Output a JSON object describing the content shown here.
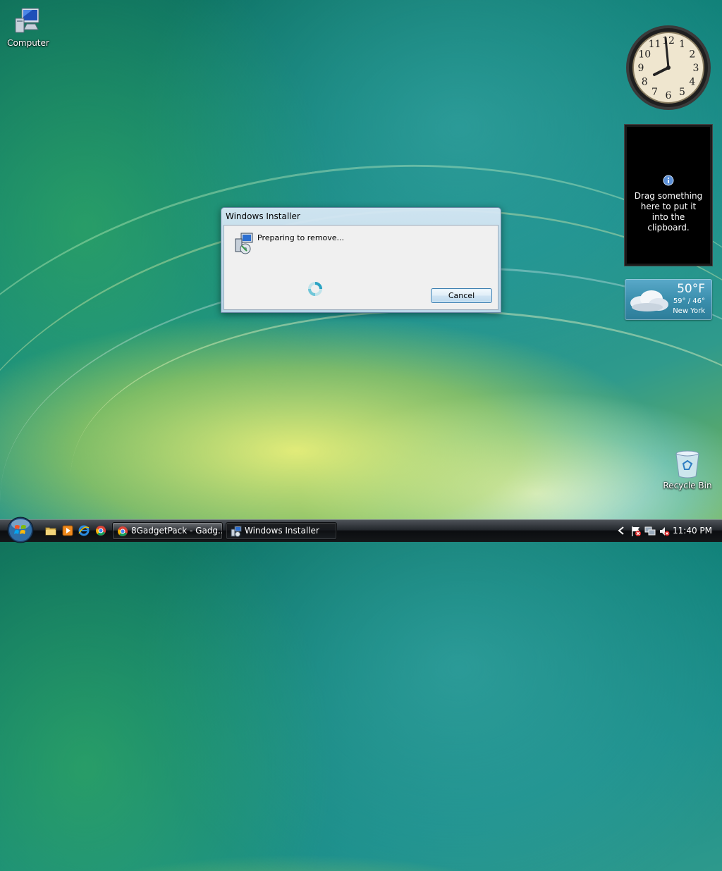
{
  "desktop": {
    "icons": [
      {
        "label": "Computer",
        "icon": "computer-icon"
      },
      {
        "label": "Recycle Bin",
        "icon": "recycle-bin-icon"
      }
    ]
  },
  "gadgets": {
    "clock": {
      "numerals": [
        "12",
        "1",
        "2",
        "3",
        "4",
        "5",
        "6",
        "7",
        "8",
        "9",
        "10",
        "11"
      ]
    },
    "clipboard": {
      "message": "Drag something here to put it into the clipboard."
    },
    "weather": {
      "temp": "50°F",
      "range": "59° / 46°",
      "city": "New York"
    }
  },
  "dialog": {
    "title": "Windows Installer",
    "status": "Preparing to remove...",
    "cancel_label": "Cancel"
  },
  "taskbar": {
    "buttons": [
      {
        "label": "8GadgetPack - Gadg...",
        "icon": "chrome-icon"
      },
      {
        "label": "Windows Installer",
        "icon": "installer-icon"
      }
    ],
    "time": "11:40 PM",
    "quick_launch": [
      "folder-icon",
      "media-player-icon",
      "internet-explorer-icon",
      "chrome-icon"
    ]
  },
  "colors": {
    "taskbar": "#141719",
    "dialog_frame": "#bcd6ea",
    "button_border": "#3c7fb1"
  }
}
